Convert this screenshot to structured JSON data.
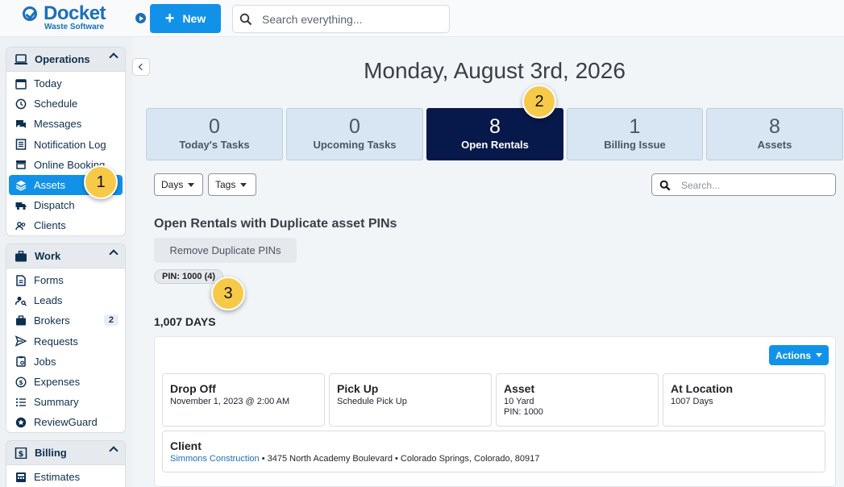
{
  "header": {
    "logo_word": "Docket",
    "logo_sub": "Waste Software",
    "new_label": "New",
    "search_placeholder": "Search everything..."
  },
  "sidebar": {
    "operations": {
      "title": "Operations",
      "items": [
        {
          "label": "Today",
          "icon": "calendar-icon"
        },
        {
          "label": "Schedule",
          "icon": "clock-icon"
        },
        {
          "label": "Messages",
          "icon": "chat-icon"
        },
        {
          "label": "Notification Log",
          "icon": "log-icon"
        },
        {
          "label": "Online Booking",
          "icon": "storefront-icon"
        },
        {
          "label": "Assets",
          "icon": "layers-icon",
          "active": true
        },
        {
          "label": "Dispatch",
          "icon": "truck-icon"
        },
        {
          "label": "Clients",
          "icon": "users-icon"
        }
      ]
    },
    "work": {
      "title": "Work",
      "items": [
        {
          "label": "Forms",
          "icon": "document-icon"
        },
        {
          "label": "Leads",
          "icon": "user-search-icon"
        },
        {
          "label": "Brokers",
          "icon": "briefcase-icon",
          "badge": "2"
        },
        {
          "label": "Requests",
          "icon": "send-icon"
        },
        {
          "label": "Jobs",
          "icon": "clipboard-icon"
        },
        {
          "label": "Expenses",
          "icon": "dollar-icon"
        },
        {
          "label": "Summary",
          "icon": "list-icon"
        },
        {
          "label": "ReviewGuard",
          "icon": "star-icon"
        }
      ]
    },
    "billing": {
      "title": "Billing",
      "items": [
        {
          "label": "Estimates",
          "icon": "calculator-icon"
        }
      ]
    }
  },
  "main": {
    "date_title": "Monday, August 3rd, 2026",
    "stats": [
      {
        "value": "0",
        "label": "Today's Tasks"
      },
      {
        "value": "0",
        "label": "Upcoming Tasks"
      },
      {
        "value": "8",
        "label": "Open Rentals"
      },
      {
        "value": "1",
        "label": "Billing Issue"
      },
      {
        "value": "8",
        "label": "Assets"
      }
    ],
    "filters": {
      "days": "Days",
      "tags": "Tags"
    },
    "search_placeholder": "Search...",
    "section_title": "Open Rentals with Duplicate asset PINs",
    "remove_label": "Remove Duplicate PINs",
    "pin_chip": "PIN: 1000 (4)",
    "days_heading": "1,007 DAYS",
    "actions_label": "Actions",
    "card": {
      "drop_off": {
        "title": "Drop Off",
        "value": "November 1, 2023 @ 2:00 AM"
      },
      "pick_up": {
        "title": "Pick Up",
        "value": "Schedule Pick Up"
      },
      "asset": {
        "title": "Asset",
        "size": "10 Yard",
        "pin": "PIN: 1000"
      },
      "at_location": {
        "title": "At Location",
        "value": "1007 Days"
      },
      "client": {
        "title": "Client",
        "name": "Simmons Construction",
        "address": " • 3475 North Academy Boulevard • Colorado Springs, Colorado, 80917"
      }
    }
  },
  "callouts": [
    "1",
    "2",
    "3"
  ],
  "colors": {
    "accent": "#1192e8",
    "selected_stat": "#07194a",
    "callout": "#f7c948"
  }
}
